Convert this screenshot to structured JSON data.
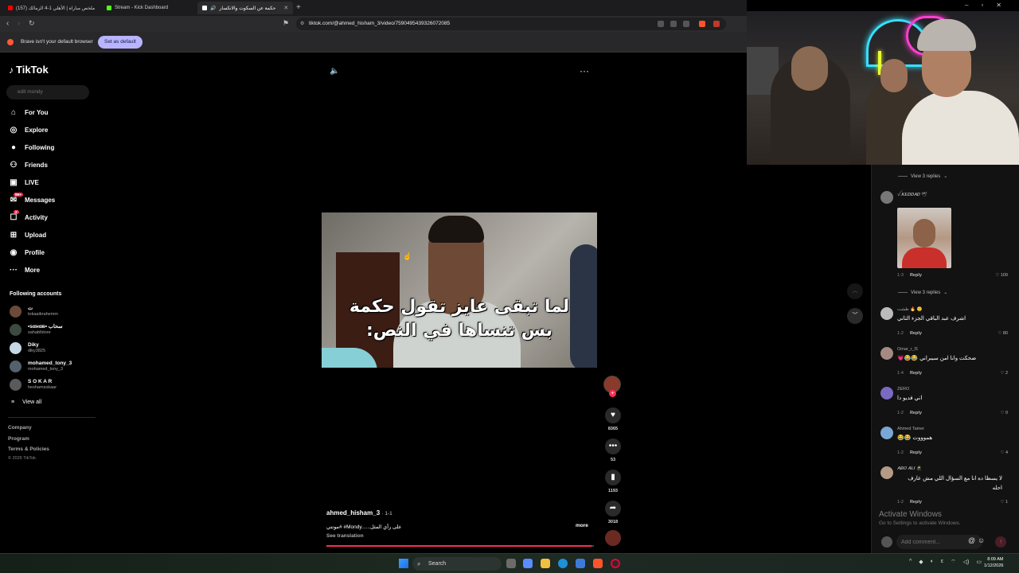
{
  "browser": {
    "tabs": [
      {
        "title": "(157) ملخص مباراة | الأهلي 1-4 الزمالك",
        "favicon_color": "#ff0000"
      },
      {
        "title": "Stream - Kick Dashboard",
        "favicon_color": "#53fc18"
      },
      {
        "title": "حكمة عن السكوت والانكسار",
        "favicon_color": "#ffffff"
      }
    ],
    "url": "tiktok.com/@ahmed_hisham_3/video/7590495439326072085",
    "infobar_message": "Brave isn't your default browser",
    "set_default_label": "Set as default"
  },
  "sidebar": {
    "logo_text": "TikTok",
    "search_placeholder": "edit mondy",
    "nav": [
      {
        "label": "For You",
        "icon": "home-icon"
      },
      {
        "label": "Explore",
        "icon": "compass-icon"
      },
      {
        "label": "Following",
        "icon": "following-icon"
      },
      {
        "label": "Friends",
        "icon": "friends-icon"
      },
      {
        "label": "LIVE",
        "icon": "live-icon"
      },
      {
        "label": "Messages",
        "icon": "messages-icon",
        "badge": "99+"
      },
      {
        "label": "Activity",
        "icon": "activity-icon",
        "badge": "2"
      },
      {
        "label": "Upload",
        "icon": "upload-icon"
      },
      {
        "label": "Profile",
        "icon": "profile-icon"
      },
      {
        "label": "More",
        "icon": "more-icon"
      }
    ],
    "following_title": "Following accounts",
    "accounts": [
      {
        "name": "ت",
        "handle": "tokaaibrahemm",
        "color": "#6b4a3a"
      },
      {
        "name": "•ѕαнαв• سحاب",
        "handle": "sahabfstore",
        "color": "#3d4a3f"
      },
      {
        "name": "Diky",
        "handle": "diky3825",
        "color": "#c7d6e6"
      },
      {
        "name": "mohamed_tony_3",
        "handle": "mohamed_tony_3",
        "color": "#55606e"
      },
      {
        "name": "S O K A R",
        "handle": "heshamsokaar",
        "color": "#5a5a5a"
      }
    ],
    "view_all": "View all",
    "footer_links": [
      "Company",
      "Program",
      "Terms & Policies"
    ],
    "copyright": "© 2026 TikTok"
  },
  "video": {
    "caption_line1": "لما تبقى عايز تقول حكمة",
    "caption_line2": "بس تنساها في النص:",
    "author": "ahmed_hisham_3",
    "date": "· 1-1",
    "description": "مونتي# #Mondy......على رأي المثل",
    "more_label": "more",
    "see_translation": "See translation",
    "progress": 0.99
  },
  "actions": {
    "likes": "8365",
    "comments": "53",
    "saves": "1193",
    "shares": "3018"
  },
  "comments": {
    "view_replies_top": "View 3 replies",
    "view_replies_mid": "View 3 replies",
    "reply_label": "Reply",
    "items": [
      {
        "user": "ꪜ.𝑲𝑬𝑫𝑫𝑨𝑫 🕊",
        "text": "",
        "date": "1-3",
        "likes": "109",
        "color": "#777"
      },
      {
        "user": "طشت 🔥 🙂",
        "text": "اشرف عبد الباقي الجزء التاني",
        "date": "1-2",
        "likes": "80",
        "color": "#bbb"
      },
      {
        "user": "Omar_r_f1",
        "text": "ضحكت وانا امن سيبراني 😂😂💗",
        "date": "1-4",
        "likes": "2",
        "color": "#a58a82"
      },
      {
        "user": "ZERO",
        "text": "اني فديو دا",
        "date": "1-2",
        "likes": "0",
        "color": "#7a6ac2"
      },
      {
        "user": "Ahmed Tamer",
        "text": "هموووت 😂😂",
        "date": "1-2",
        "likes": "4",
        "color": "#7aa7d6"
      },
      {
        "user": "𝑨𝑩𝑶 𝑨𝑳𝑰 🥷",
        "text": "لا يسطا ده انا مع السؤال اللي مش عارف احله",
        "date": "1-2",
        "likes": "1",
        "color": "#b59a86"
      }
    ],
    "input_placeholder": "Add comment..."
  },
  "watermark": {
    "line1": "Activate Windows",
    "line2": "Go to Settings to activate Windows."
  },
  "taskbar": {
    "search_label": "Search",
    "time": "8:09 AM",
    "date": "1/12/2026"
  }
}
